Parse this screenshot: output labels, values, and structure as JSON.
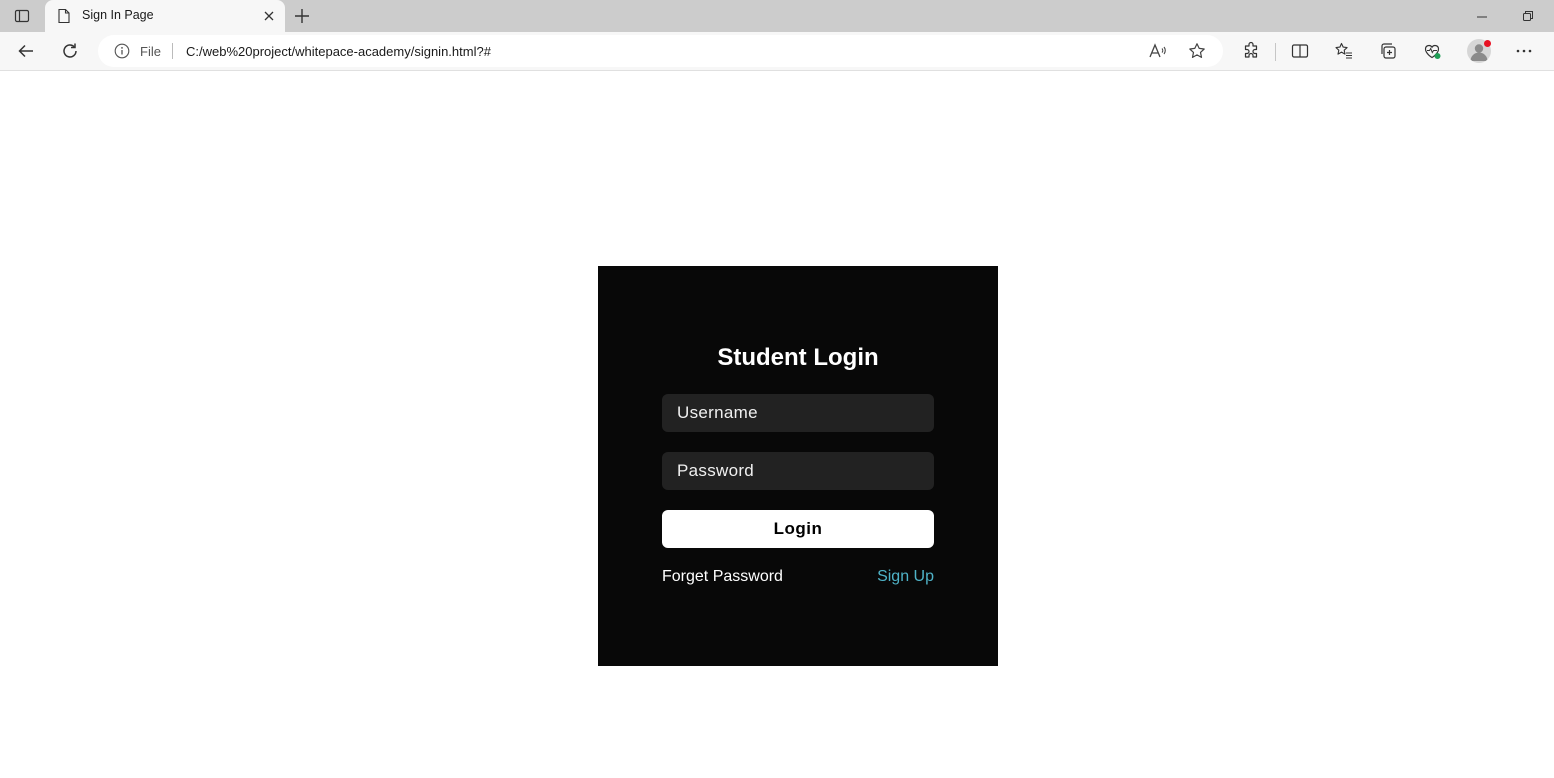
{
  "browser": {
    "tab": {
      "title": "Sign In Page"
    },
    "address_bar": {
      "scheme_label": "File",
      "url": "C:/web%20project/whitepace-academy/signin.html?#"
    }
  },
  "page": {
    "title": "Student Login",
    "username": {
      "placeholder": "Username"
    },
    "password": {
      "placeholder": "Password"
    },
    "login_button": "Login",
    "forget_password": "Forget Password",
    "sign_up": "Sign Up"
  },
  "colors": {
    "card_background": "#080808",
    "input_background": "#222222",
    "button_background": "#ffffff",
    "signup_link": "#4fb3c8"
  },
  "icons": [
    "tab-actions-icon",
    "page-icon",
    "close-icon",
    "plus-icon",
    "minimize-icon",
    "restore-icon",
    "back-icon",
    "refresh-icon",
    "info-icon",
    "read-aloud-icon",
    "star-icon",
    "extensions-icon",
    "split-screen-icon",
    "favorites-icon",
    "collections-icon",
    "browser-essentials-icon",
    "profile-icon",
    "more-icon"
  ]
}
